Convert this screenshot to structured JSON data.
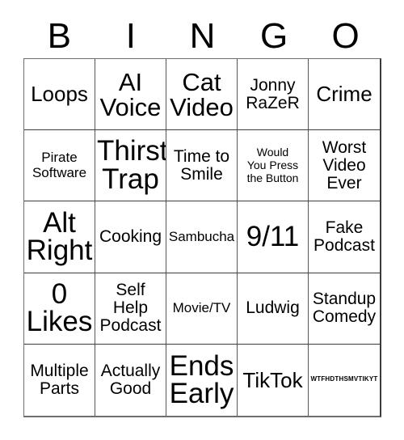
{
  "card": {
    "header_letters": [
      "B",
      "I",
      "N",
      "G",
      "O"
    ],
    "columns": 5,
    "rows": 5,
    "colors": {
      "background": "#ffffff",
      "text": "#000000",
      "grid_line": "#555555",
      "outer_border": "#3a3a3a"
    },
    "cells": [
      {
        "text": "Loops",
        "size": "lg"
      },
      {
        "text": "AI\nVoice",
        "size": "xl"
      },
      {
        "text": "Cat\nVideo",
        "size": "xl"
      },
      {
        "text": "Jonny\nRaZeR",
        "size": "md"
      },
      {
        "text": "Crime",
        "size": "lg"
      },
      {
        "text": "Pirate\nSoftware",
        "size": "sm"
      },
      {
        "text": "Thirst\nTrap",
        "size": "xxl"
      },
      {
        "text": "Time to\nSmile",
        "size": "md"
      },
      {
        "text": "Would\nYou Press\nthe Button",
        "size": "xs"
      },
      {
        "text": "Worst\nVideo\nEver",
        "size": "md"
      },
      {
        "text": "Alt\nRight",
        "size": "xxl"
      },
      {
        "text": "Cooking",
        "size": "md"
      },
      {
        "text": "Sambucha",
        "size": "sm"
      },
      {
        "text": "9/11",
        "size": "xxl"
      },
      {
        "text": "Fake\nPodcast",
        "size": "md"
      },
      {
        "text": "0\nLikes",
        "size": "xxl"
      },
      {
        "text": "Self\nHelp\nPodcast",
        "size": "md"
      },
      {
        "text": "Movie/TV",
        "size": "sm"
      },
      {
        "text": "Ludwig",
        "size": "md"
      },
      {
        "text": "Standup\nComedy",
        "size": "md"
      },
      {
        "text": "Multiple\nParts",
        "size": "md"
      },
      {
        "text": "Actually\nGood",
        "size": "md"
      },
      {
        "text": "Ends\nEarly",
        "size": "xxl"
      },
      {
        "text": "TikTok",
        "size": "lg"
      },
      {
        "text": "WTFHDTHSMVTIKYT",
        "size": "xxs"
      }
    ]
  }
}
